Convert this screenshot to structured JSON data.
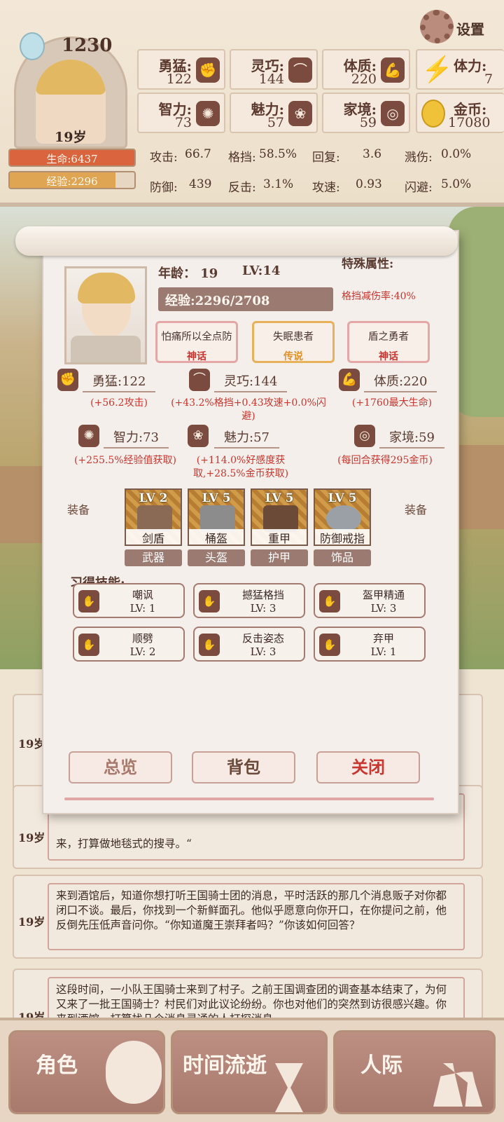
{
  "header": {
    "score": "1230",
    "age_badge": "19岁",
    "hp": "生命:6437",
    "exp": "经验:2296",
    "settings": "设置",
    "stats": [
      {
        "label": "勇猛:",
        "value": "122",
        "icon": "fist-icon"
      },
      {
        "label": "灵巧:",
        "value": "144",
        "icon": "cloak-icon"
      },
      {
        "label": "体质:",
        "value": "220",
        "icon": "arm-icon"
      },
      {
        "label": "智力:",
        "value": "73",
        "icon": "brain-icon"
      },
      {
        "label": "魅力:",
        "value": "57",
        "icon": "flower-icon"
      },
      {
        "label": "家境:",
        "value": "59",
        "icon": "coin-hand-icon"
      }
    ],
    "stamina_label": "体力:",
    "stamina_value": "7",
    "gold_label": "金币:",
    "gold_value": "17080",
    "combat": [
      [
        "攻击:",
        "66.7",
        "格挡:",
        "58.5%",
        "回复:",
        "3.6",
        "溅伤:",
        "0.0%"
      ],
      [
        "防御:",
        "439",
        "反击:",
        "3.1%",
        "攻速:",
        "0.93",
        "闪避:",
        "5.0%"
      ]
    ]
  },
  "logs": [
    {
      "age": "19岁",
      "text": ""
    },
    {
      "age": "19岁",
      "text": "来，打算做地毯式的搜寻。“"
    },
    {
      "age": "19岁",
      "text": "来到酒馆后，知道你想打听王国骑士团的消息，平时活跃的那几个消息贩子对你都闭口不谈。最后，你找到一个新鲜面孔。他似乎愿意向你开口，在你提问之前，他反倒先压低声音问你。“你知道魔王崇拜者吗？”你该如何回答？"
    },
    {
      "age": "19岁",
      "text": "这段时间，一小队王国骑士来到了村子。之前王国调查团的调查基本结束了，为何又来了一批王国骑士？村民们对此议论纷纷。你也对他们的突然到访很感兴趣。你来到酒馆，打算找几个消息灵通的人打探消息。"
    }
  ],
  "modal": {
    "age": "年龄： 19",
    "level": "LV:14",
    "special_title": "特殊属性:",
    "special_value": "格挡减伤率:40%",
    "exp": "经验:2296/2708",
    "traits": [
      {
        "name": "怕痛所以全点防",
        "rarity": "神话",
        "color": "#c9352f",
        "border": "#e3a7a7"
      },
      {
        "name": "失眠患者",
        "rarity": "传说",
        "color": "#e0912a",
        "border": "#e8b25a"
      },
      {
        "name": "盾之勇者",
        "rarity": "神话",
        "color": "#c9352f",
        "border": "#e3a7a7"
      }
    ],
    "attrs": [
      {
        "name": "勇猛:122",
        "bonus": "(+56.2攻击)",
        "icon": "fist-icon"
      },
      {
        "name": "灵巧:144",
        "bonus": "(+43.2%格挡+0.43攻速+0.0%闪避)",
        "icon": "cloak-icon"
      },
      {
        "name": "体质:220",
        "bonus": "(+1760最大生命)",
        "icon": "arm-icon"
      },
      {
        "name": "智力:73",
        "bonus": "(+255.5%经验值获取)",
        "icon": "brain-icon"
      },
      {
        "name": "魅力:57",
        "bonus": "(+114.0%好感度获取,+28.5%金币获取)",
        "icon": "flower-icon"
      },
      {
        "name": "家境:59",
        "bonus": "(每回合获得295金币)",
        "icon": "coin-hand-icon"
      }
    ],
    "equip_label_left": "装备",
    "equip_label_right": "装备",
    "equipment": [
      {
        "level": "LV 2",
        "name": "剑盾",
        "slot": "武器"
      },
      {
        "level": "LV 5",
        "name": "桶盔",
        "slot": "头盔"
      },
      {
        "level": "LV 5",
        "name": "重甲",
        "slot": "护甲"
      },
      {
        "level": "LV 5",
        "name": "防御戒指",
        "slot": "饰品"
      }
    ],
    "skills_title": "习得技能:",
    "skills": [
      {
        "name": "嘲讽",
        "level": "LV: 1"
      },
      {
        "name": "撼猛格挡",
        "level": "LV: 3"
      },
      {
        "name": "盔甲精通",
        "level": "LV: 3"
      },
      {
        "name": "顺劈",
        "level": "LV: 2"
      },
      {
        "name": "反击姿态",
        "level": "LV: 3"
      },
      {
        "name": "弃甲",
        "level": "LV: 1"
      }
    ],
    "buttons": {
      "overview": "总览",
      "bag": "背包",
      "close": "关闭"
    }
  },
  "nav": {
    "role": "角色",
    "time": "时间流逝",
    "social": "人际"
  }
}
